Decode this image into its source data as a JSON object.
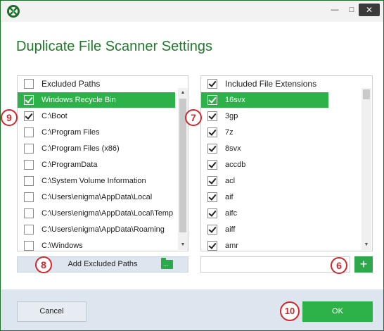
{
  "window": {
    "minimize_glyph": "—",
    "maximize_glyph": "□",
    "close_glyph": "✕"
  },
  "title": "Duplicate File Scanner Settings",
  "excluded": {
    "header": "Excluded Paths",
    "items": [
      {
        "label": "Windows Recycle Bin",
        "checked": true,
        "selected": true
      },
      {
        "label": "C:\\Boot",
        "checked": true,
        "selected": false
      },
      {
        "label": "C:\\Program Files",
        "checked": false,
        "selected": false
      },
      {
        "label": "C:\\Program Files (x86)",
        "checked": false,
        "selected": false
      },
      {
        "label": "C:\\ProgramData",
        "checked": false,
        "selected": false
      },
      {
        "label": "C:\\System Volume Information",
        "checked": false,
        "selected": false
      },
      {
        "label": "C:\\Users\\enigma\\AppData\\Local",
        "checked": false,
        "selected": false
      },
      {
        "label": "C:\\Users\\enigma\\AppData\\Local\\Temp",
        "checked": false,
        "selected": false
      },
      {
        "label": "C:\\Users\\enigma\\AppData\\Roaming",
        "checked": false,
        "selected": false
      },
      {
        "label": "C:\\Windows",
        "checked": false,
        "selected": false
      }
    ],
    "add_button": "Add Excluded Paths"
  },
  "included": {
    "header": "Included File Extensions",
    "items": [
      {
        "label": "16svx",
        "checked": true,
        "selected": true
      },
      {
        "label": "3gp",
        "checked": true,
        "selected": false
      },
      {
        "label": "7z",
        "checked": true,
        "selected": false
      },
      {
        "label": "8svx",
        "checked": true,
        "selected": false
      },
      {
        "label": "accdb",
        "checked": true,
        "selected": false
      },
      {
        "label": "acl",
        "checked": true,
        "selected": false
      },
      {
        "label": "aif",
        "checked": true,
        "selected": false
      },
      {
        "label": "aifc",
        "checked": true,
        "selected": false
      },
      {
        "label": "aiff",
        "checked": true,
        "selected": false
      },
      {
        "label": "amr",
        "checked": true,
        "selected": false
      }
    ],
    "extension_input_value": "",
    "add_button_glyph": "+"
  },
  "footer": {
    "cancel": "Cancel",
    "ok": "OK"
  },
  "badges": {
    "six": "6",
    "seven": "7",
    "eight": "8",
    "nine": "9",
    "ten": "10"
  },
  "colors": {
    "accent_green": "#2db24a",
    "title_green": "#1f7a2a",
    "badge_red": "#d4242c",
    "footer_bg": "#dde6ee"
  }
}
